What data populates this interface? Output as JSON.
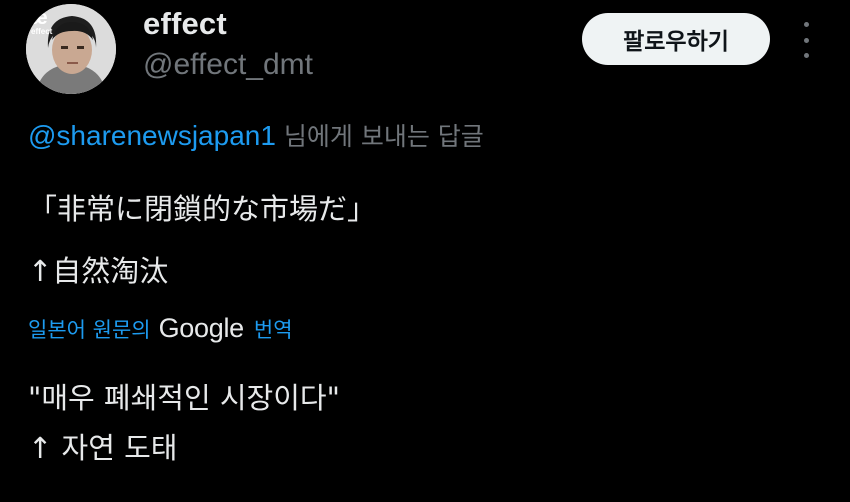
{
  "profile": {
    "display_name": "effect",
    "handle": "@effect_dmt",
    "avatar_text": "effect"
  },
  "actions": {
    "follow_label": "팔로우하기",
    "more_icon": "more-vertical-icon"
  },
  "reply": {
    "mention": "@sharenewsjapan1",
    "suffix": " 님에게 보내는 답글"
  },
  "tweet": {
    "lines": [
      "「非常に閉鎖的な市場だ」",
      "↑自然淘汰"
    ]
  },
  "translation": {
    "prefix": "일본어 원문의",
    "brand": "Google",
    "suffix": "번역",
    "lines": [
      "\"매우 폐쇄적인 시장이다\"",
      "↑ 자연 도태"
    ]
  },
  "colors": {
    "background": "#000000",
    "accent": "#1d9bf0",
    "muted": "#71767b",
    "text": "#e7e9ea"
  }
}
